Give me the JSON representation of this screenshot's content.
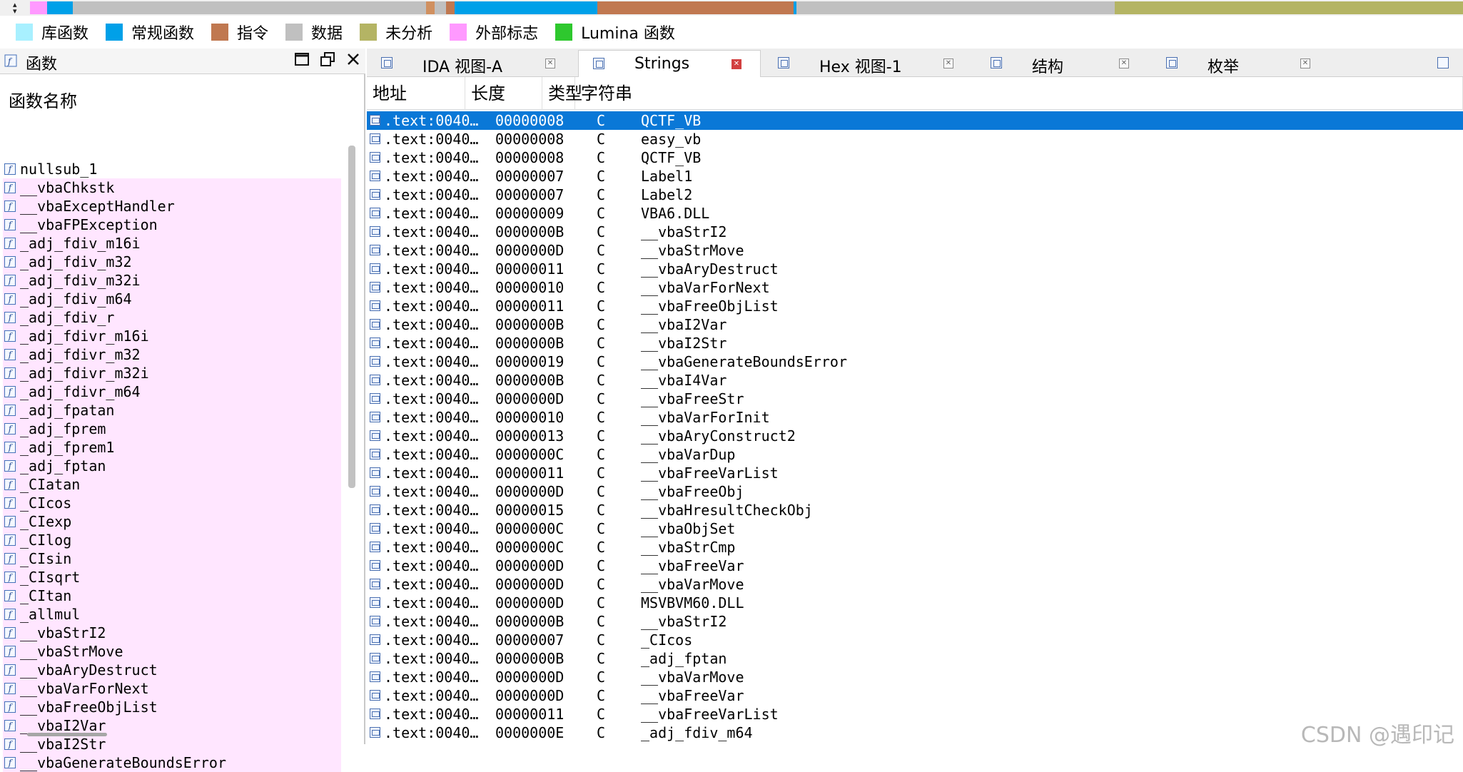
{
  "navband": {
    "arrows_icon": "nav-arrows-icon",
    "segments": [
      {
        "color": "#ff99ff",
        "w": 24
      },
      {
        "color": "#00a0e8",
        "w": 36
      },
      {
        "color": "#c0c0c0",
        "w": 495
      },
      {
        "color": "#d09060",
        "w": 12
      },
      {
        "color": "#c0c0c0",
        "w": 16
      },
      {
        "color": "#c07850",
        "w": 12
      },
      {
        "color": "#00a0e8",
        "w": 200
      },
      {
        "color": "#c07850",
        "w": 275
      },
      {
        "color": "#00a0e8",
        "w": 4
      },
      {
        "color": "#c0c0c0",
        "w": 446
      },
      {
        "color": "#b4b464",
        "w": 488
      }
    ]
  },
  "legend": [
    {
      "label": "库函数",
      "color": "#a8f0ff"
    },
    {
      "label": "常规函数",
      "color": "#00a0e8"
    },
    {
      "label": "指令",
      "color": "#c07850"
    },
    {
      "label": "数据",
      "color": "#c0c0c0"
    },
    {
      "label": "未分析",
      "color": "#b4b464"
    },
    {
      "label": "外部标志",
      "color": "#ff99ff"
    },
    {
      "label": "Lumina 函数",
      "color": "#2ec82e"
    }
  ],
  "functions_panel": {
    "title": "函数",
    "column_header": "函数名称",
    "items": [
      {
        "name": "nullsub_1",
        "kind": "regular"
      },
      {
        "name": "__vbaChkstk",
        "kind": "library"
      },
      {
        "name": "__vbaExceptHandler",
        "kind": "library"
      },
      {
        "name": "__vbaFPException",
        "kind": "library"
      },
      {
        "name": "_adj_fdiv_m16i",
        "kind": "library"
      },
      {
        "name": "_adj_fdiv_m32",
        "kind": "library"
      },
      {
        "name": "_adj_fdiv_m32i",
        "kind": "library"
      },
      {
        "name": "_adj_fdiv_m64",
        "kind": "library"
      },
      {
        "name": "_adj_fdiv_r",
        "kind": "library"
      },
      {
        "name": "_adj_fdivr_m16i",
        "kind": "library"
      },
      {
        "name": "_adj_fdivr_m32",
        "kind": "library"
      },
      {
        "name": "_adj_fdivr_m32i",
        "kind": "library"
      },
      {
        "name": "_adj_fdivr_m64",
        "kind": "library"
      },
      {
        "name": "_adj_fpatan",
        "kind": "library"
      },
      {
        "name": "_adj_fprem",
        "kind": "library"
      },
      {
        "name": "_adj_fprem1",
        "kind": "library"
      },
      {
        "name": "_adj_fptan",
        "kind": "library"
      },
      {
        "name": "_CIatan",
        "kind": "library"
      },
      {
        "name": "_CIcos",
        "kind": "library"
      },
      {
        "name": "_CIexp",
        "kind": "library"
      },
      {
        "name": "_CIlog",
        "kind": "library"
      },
      {
        "name": "_CIsin",
        "kind": "library"
      },
      {
        "name": "_CIsqrt",
        "kind": "library"
      },
      {
        "name": "_CItan",
        "kind": "library"
      },
      {
        "name": "_allmul",
        "kind": "library"
      },
      {
        "name": "__vbaStrI2",
        "kind": "library"
      },
      {
        "name": "__vbaStrMove",
        "kind": "library"
      },
      {
        "name": "__vbaAryDestruct",
        "kind": "library"
      },
      {
        "name": "__vbaVarForNext",
        "kind": "library"
      },
      {
        "name": "__vbaFreeObjList",
        "kind": "library"
      },
      {
        "name": "__vbaI2Var",
        "kind": "library"
      },
      {
        "name": "__vbaI2Str",
        "kind": "library"
      },
      {
        "name": "__vbaGenerateBoundsError",
        "kind": "library"
      }
    ]
  },
  "tabs": [
    {
      "label": "IDA 视图-A",
      "active": false,
      "icon": "disassembly-view-icon"
    },
    {
      "label": "Strings",
      "active": true,
      "icon": "strings-window-icon"
    },
    {
      "label": "Hex 视图-1",
      "active": false,
      "icon": "hex-view-icon"
    },
    {
      "label": "结构",
      "active": false,
      "icon": "structures-icon"
    },
    {
      "label": "枚举",
      "active": false,
      "icon": "enums-icon"
    }
  ],
  "strings_table": {
    "columns": [
      "地址",
      "长度",
      "类型",
      "字符串"
    ],
    "rows": [
      {
        "addr": ".text:0040…",
        "len": "00000008",
        "type": "C",
        "str": "QCTF_VB",
        "selected": true
      },
      {
        "addr": ".text:0040…",
        "len": "00000008",
        "type": "C",
        "str": "easy_vb"
      },
      {
        "addr": ".text:0040…",
        "len": "00000008",
        "type": "C",
        "str": "QCTF_VB"
      },
      {
        "addr": ".text:0040…",
        "len": "00000007",
        "type": "C",
        "str": "Label1"
      },
      {
        "addr": ".text:0040…",
        "len": "00000007",
        "type": "C",
        "str": "Label2"
      },
      {
        "addr": ".text:0040…",
        "len": "00000009",
        "type": "C",
        "str": "VBA6.DLL"
      },
      {
        "addr": ".text:0040…",
        "len": "0000000B",
        "type": "C",
        "str": "__vbaStrI2"
      },
      {
        "addr": ".text:0040…",
        "len": "0000000D",
        "type": "C",
        "str": "__vbaStrMove"
      },
      {
        "addr": ".text:0040…",
        "len": "00000011",
        "type": "C",
        "str": "__vbaAryDestruct"
      },
      {
        "addr": ".text:0040…",
        "len": "00000010",
        "type": "C",
        "str": "__vbaVarForNext"
      },
      {
        "addr": ".text:0040…",
        "len": "00000011",
        "type": "C",
        "str": "__vbaFreeObjList"
      },
      {
        "addr": ".text:0040…",
        "len": "0000000B",
        "type": "C",
        "str": "__vbaI2Var"
      },
      {
        "addr": ".text:0040…",
        "len": "0000000B",
        "type": "C",
        "str": "__vbaI2Str"
      },
      {
        "addr": ".text:0040…",
        "len": "00000019",
        "type": "C",
        "str": "__vbaGenerateBoundsError"
      },
      {
        "addr": ".text:0040…",
        "len": "0000000B",
        "type": "C",
        "str": "__vbaI4Var"
      },
      {
        "addr": ".text:0040…",
        "len": "0000000D",
        "type": "C",
        "str": "__vbaFreeStr"
      },
      {
        "addr": ".text:0040…",
        "len": "00000010",
        "type": "C",
        "str": "__vbaVarForInit"
      },
      {
        "addr": ".text:0040…",
        "len": "00000013",
        "type": "C",
        "str": "__vbaAryConstruct2"
      },
      {
        "addr": ".text:0040…",
        "len": "0000000C",
        "type": "C",
        "str": "__vbaVarDup"
      },
      {
        "addr": ".text:0040…",
        "len": "00000011",
        "type": "C",
        "str": "__vbaFreeVarList"
      },
      {
        "addr": ".text:0040…",
        "len": "0000000D",
        "type": "C",
        "str": "__vbaFreeObj"
      },
      {
        "addr": ".text:0040…",
        "len": "00000015",
        "type": "C",
        "str": "__vbaHresultCheckObj"
      },
      {
        "addr": ".text:0040…",
        "len": "0000000C",
        "type": "C",
        "str": "__vbaObjSet"
      },
      {
        "addr": ".text:0040…",
        "len": "0000000C",
        "type": "C",
        "str": "__vbaStrCmp"
      },
      {
        "addr": ".text:0040…",
        "len": "0000000D",
        "type": "C",
        "str": "__vbaFreeVar"
      },
      {
        "addr": ".text:0040…",
        "len": "0000000D",
        "type": "C",
        "str": "__vbaVarMove"
      },
      {
        "addr": ".text:0040…",
        "len": "0000000D",
        "type": "C",
        "str": "MSVBVM60.DLL"
      },
      {
        "addr": ".text:0040…",
        "len": "0000000B",
        "type": "C",
        "str": "__vbaStrI2"
      },
      {
        "addr": ".text:0040…",
        "len": "00000007",
        "type": "C",
        "str": "_CIcos"
      },
      {
        "addr": ".text:0040…",
        "len": "0000000B",
        "type": "C",
        "str": "_adj_fptan"
      },
      {
        "addr": ".text:0040…",
        "len": "0000000D",
        "type": "C",
        "str": "__vbaVarMove"
      },
      {
        "addr": ".text:0040…",
        "len": "0000000D",
        "type": "C",
        "str": "__vbaFreeVar"
      },
      {
        "addr": ".text:0040…",
        "len": "00000011",
        "type": "C",
        "str": "__vbaFreeVarList"
      },
      {
        "addr": ".text:0040…",
        "len": "0000000E",
        "type": "C",
        "str": "_adj_fdiv_m64"
      }
    ]
  },
  "watermark": "CSDN @遇印记"
}
